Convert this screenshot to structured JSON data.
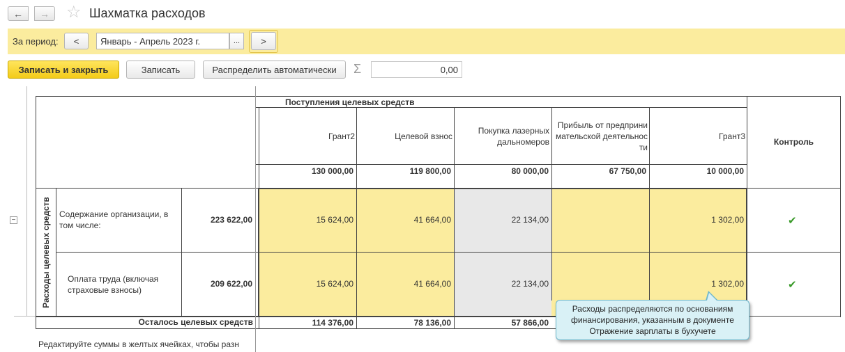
{
  "window": {
    "title": "Шахматка расходов",
    "back_glyph": "←",
    "forward_glyph": "→",
    "favorite_glyph": "☆"
  },
  "period": {
    "label": "За период:",
    "prev_label": "<",
    "value": "Январь - Апрель 2023 г.",
    "select_label": "...",
    "next_label": ">"
  },
  "toolbar": {
    "save_close_label": "Записать и закрыть",
    "save_label": "Записать",
    "distribute_label": "Распределить автоматически",
    "sigma_glyph": "Σ",
    "sum_value": "0,00"
  },
  "table": {
    "group_header": "Поступления целевых средств",
    "columns": [
      {
        "name": "Грант2",
        "total": "130 000,00"
      },
      {
        "name": "Целевой взнос",
        "total": "119 800,00"
      },
      {
        "name": "Покупка лазерных дальномеров",
        "total": "80 000,00"
      },
      {
        "name": "Прибыль от предпринимательской деятельности",
        "total": "67 750,00"
      },
      {
        "name": "Грант3",
        "total": "10 000,00"
      }
    ],
    "control_header": "Контроль",
    "vertical_label": "Расходы целевых средств",
    "collapse_glyph": "−",
    "check_glyph": "✔",
    "rows": [
      {
        "label": "Содержание организации, в том числе:",
        "total": "223 622,00",
        "values": [
          "15 624,00",
          "41 664,00",
          "22 134,00",
          "",
          "1 302,00"
        ]
      },
      {
        "label": "Оплата труда (включая страховые взносы)",
        "total": "209 622,00",
        "values": [
          "15 624,00",
          "41 664,00",
          "22 134,00",
          "",
          "1 302,00"
        ]
      }
    ],
    "remaining_label": "Осталось целевых средств",
    "remaining_values": [
      "114 376,00",
      "78 136,00",
      "57 866,00"
    ]
  },
  "hint": "Редактируйте суммы в желтых ячейках, чтобы разн",
  "tooltip": "Расходы распределяются по основаниям финансирования, указанным в документе Отражение зарплаты в бухучете"
}
